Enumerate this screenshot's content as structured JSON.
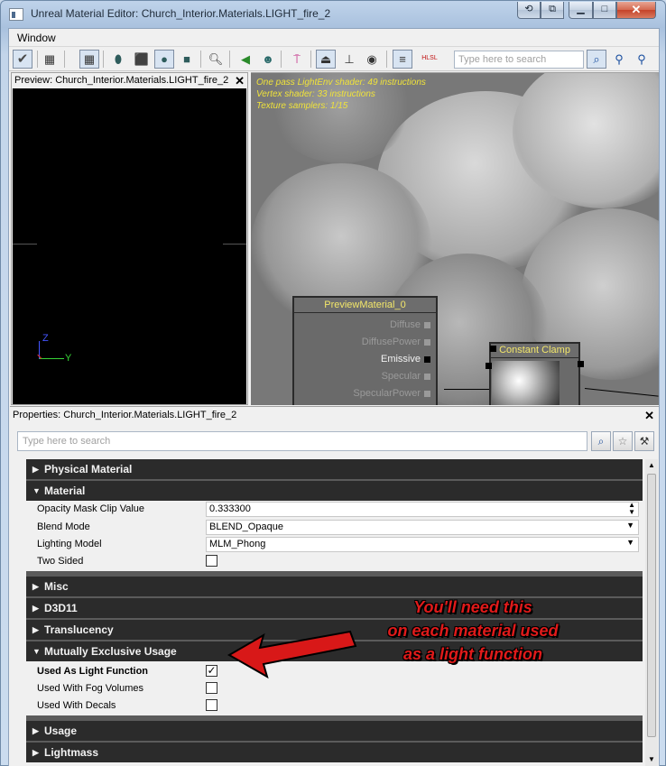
{
  "window": {
    "title": "Unreal Material Editor: Church_Interior.Materials.LIGHT_fire_2",
    "controls": {
      "minimize": "▁",
      "maximize": "□",
      "close": "✕"
    }
  },
  "menu": {
    "items": [
      "Window"
    ]
  },
  "toolbar": {
    "search_placeholder": "Type here to search",
    "hlsl_label": "HLSL"
  },
  "preview": {
    "title": "Preview: Church_Interior.Materials.LIGHT_fire_2",
    "axis_z": "Z",
    "axis_y": "Y"
  },
  "graph": {
    "stats": [
      "One pass LightEnv shader: 49 instructions",
      "Vertex shader: 33 instructions",
      "Texture samplers: 1/15"
    ],
    "node": {
      "title": "PreviewMaterial_0",
      "pins": [
        "Diffuse",
        "DiffusePower",
        "Emissive",
        "Specular",
        "SpecularPower"
      ],
      "active_pin": "Emissive"
    },
    "clamp": {
      "title": "Constant Clamp"
    }
  },
  "properties": {
    "title": "Properties: Church_Interior.Materials.LIGHT_fire_2",
    "search_placeholder": "Type here to search",
    "categories": {
      "physical": "Physical Material",
      "material": "Material",
      "misc": "Misc",
      "d3d11": "D3D11",
      "translucency": "Translucency",
      "mutually": "Mutually Exclusive Usage",
      "usage": "Usage",
      "lightmass": "Lightmass"
    },
    "material_rows": {
      "opacity_label": "Opacity Mask Clip Value",
      "opacity_value": "0.333300",
      "blend_label": "Blend Mode",
      "blend_value": "BLEND_Opaque",
      "lighting_label": "Lighting Model",
      "lighting_value": "MLM_Phong",
      "twosided_label": "Two Sided"
    },
    "usage_rows": {
      "light_function_label": "Used As Light Function",
      "light_function_checked": true,
      "fog_label": "Used With Fog Volumes",
      "decals_label": "Used With Decals"
    }
  },
  "annotation": {
    "line1": "You'll need this",
    "line2": "on each material used",
    "line3": "as a light function"
  },
  "colors": {
    "accent_yellow": "#f3e76a",
    "annotation_red": "#e01a1a"
  }
}
